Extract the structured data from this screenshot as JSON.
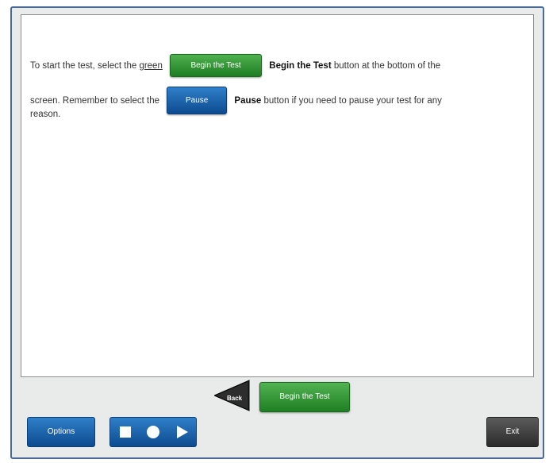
{
  "instructions": {
    "line1_prefix": "To start the test, select the ",
    "line1_green_word": "green",
    "line1_button_label": "Begin the Test",
    "line1_bold": "Begin the Test",
    "line1_suffix": " button at the bottom of the",
    "line2_prefix": "screen. Remember to select the",
    "line2_button_label": "Pause",
    "line2_bold": "Pause",
    "line2_suffix": " button if you need to pause your test for any",
    "line3": "reason."
  },
  "navigation": {
    "back_label": "Back",
    "begin_label": "Begin the Test"
  },
  "toolbar": {
    "options_label": "Options",
    "exit_label": "Exit",
    "media_icons": [
      "stop-icon",
      "record-icon",
      "play-icon"
    ]
  },
  "colors": {
    "frame_border": "#4a6a9a",
    "primary_blue": "#0d4b8f",
    "begin_green": "#1e7d22",
    "exit_dark": "#2b2b2b"
  }
}
